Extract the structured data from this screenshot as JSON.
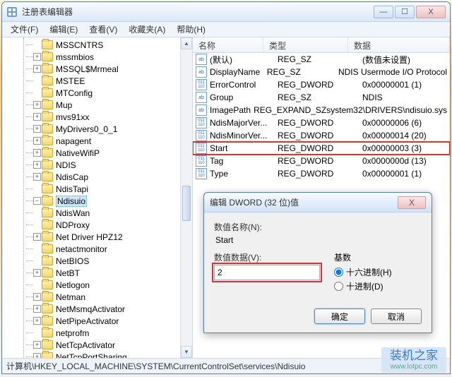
{
  "window": {
    "title": "注册表编辑器",
    "min": "—",
    "max": "☐",
    "close": "X"
  },
  "menu": {
    "file": "文件(F)",
    "edit": "编辑(E)",
    "view": "查看(V)",
    "fav": "收藏夹(A)",
    "help": "帮助(H)"
  },
  "tree": [
    "MSSCNTRS",
    "mssmbios",
    "MSSQL$Mrmeal",
    "MSTEE",
    "MTConfig",
    "Mup",
    "mvs91xx",
    "MyDrivers0_0_1",
    "napagent",
    "NativeWifiP",
    "NDIS",
    "NdisCap",
    "NdisTapi",
    "Ndisuio",
    "NdisWan",
    "NDProxy",
    "Net Driver HPZ12",
    "netactmonitor",
    "NetBIOS",
    "NetBT",
    "Netlogon",
    "Netman",
    "NetMsmqActivator",
    "NetPipeActivator",
    "netprofm",
    "NetTcpActivator",
    "NetTcpPortSharing"
  ],
  "tree_selected_index": 13,
  "list": {
    "headers": {
      "name": "名称",
      "type": "类型",
      "data": "数据"
    },
    "rows": [
      {
        "icon": "ab",
        "name": "(默认)",
        "type": "REG_SZ",
        "data": "(数值未设置)"
      },
      {
        "icon": "ab",
        "name": "DisplayName",
        "type": "REG_SZ",
        "data": "NDIS Usermode I/O Protocol"
      },
      {
        "icon": "num",
        "name": "ErrorControl",
        "type": "REG_DWORD",
        "data": "0x00000001 (1)"
      },
      {
        "icon": "ab",
        "name": "Group",
        "type": "REG_SZ",
        "data": "NDIS"
      },
      {
        "icon": "ab",
        "name": "ImagePath",
        "type": "REG_EXPAND_SZ",
        "data": "system32\\DRIVERS\\ndisuio.sys"
      },
      {
        "icon": "num",
        "name": "NdisMajorVer...",
        "type": "REG_DWORD",
        "data": "0x00000006 (6)"
      },
      {
        "icon": "num",
        "name": "NdisMinorVer...",
        "type": "REG_DWORD",
        "data": "0x00000014 (20)"
      },
      {
        "icon": "num",
        "name": "Start",
        "type": "REG_DWORD",
        "data": "0x00000003 (3)",
        "hl": true
      },
      {
        "icon": "num",
        "name": "Tag",
        "type": "REG_DWORD",
        "data": "0x0000000d (13)"
      },
      {
        "icon": "num",
        "name": "Type",
        "type": "REG_DWORD",
        "data": "0x00000001 (1)"
      }
    ]
  },
  "dialog": {
    "title": "编辑 DWORD (32 位)值",
    "name_label": "数值名称(N):",
    "name_value": "Start",
    "data_label": "数值数据(V):",
    "data_value": "2",
    "base_label": "基数",
    "radio_hex": "十六进制(H)",
    "radio_dec": "十进制(D)",
    "ok": "确定",
    "cancel": "取消",
    "close": "X"
  },
  "statusbar": "计算机\\HKEY_LOCAL_MACHINE\\SYSTEM\\CurrentControlSet\\services\\Ndisuio",
  "watermark": {
    "main": "装机之家",
    "sub": "www.lotpc.com"
  }
}
